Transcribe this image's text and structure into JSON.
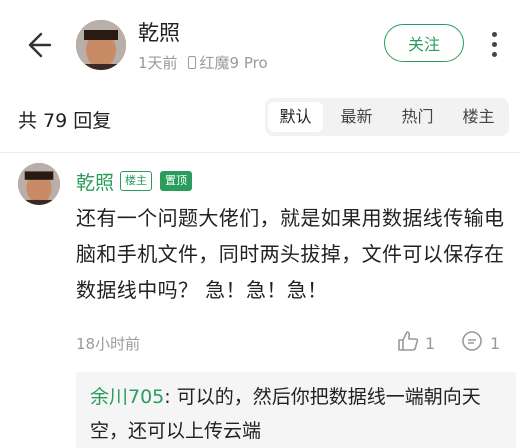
{
  "header": {
    "author_name": "乾照",
    "time_ago": "1天前",
    "device": "红魔9 Pro",
    "follow_label": "关注"
  },
  "reply_bar": {
    "count_text": "共 79 回复",
    "sort_options": [
      "默认",
      "最新",
      "热门",
      "楼主"
    ],
    "active_sort": "默认"
  },
  "comment": {
    "author_name": "乾照",
    "tag_host": "楼主",
    "tag_pinned": "置顶",
    "body": "还有一个问题大佬们，就是如果用数据线传输电脑和手机文件，同时两头拔掉，文件可以保存在数据线中吗？ 急！急！急！",
    "time": "18小时前",
    "like_count": "1",
    "reply_count": "1",
    "sub_reply": {
      "name": "余川705",
      "text": ": 可以的，然后你把数据线一端朝向天空，还可以上传云端"
    }
  },
  "colors": {
    "accent": "#2a9d5c",
    "muted": "#9a9a9a"
  },
  "icons": {
    "back": "back-arrow-icon",
    "more": "more-vertical-icon",
    "device": "phone-icon",
    "like": "thumbs-up-icon",
    "reply": "comment-icon"
  }
}
